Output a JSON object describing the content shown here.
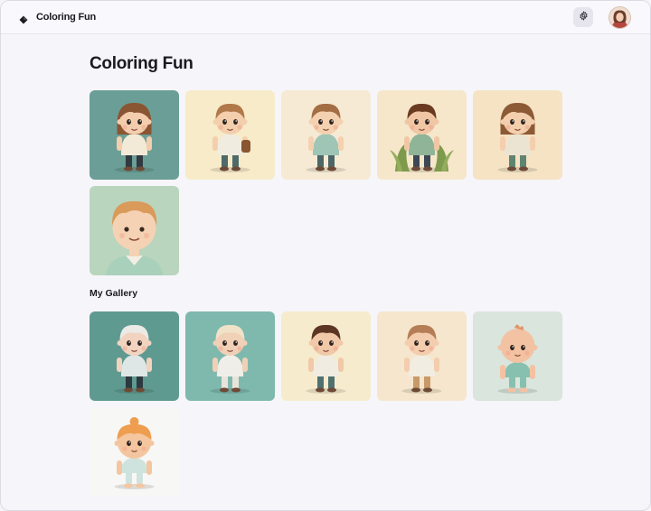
{
  "app": {
    "name": "Coloring Fun",
    "logo_icon": "diamond-logo-icon"
  },
  "header": {
    "settings_icon": "gear-icon",
    "avatar": "user-avatar"
  },
  "page": {
    "title": "Coloring Fun"
  },
  "sections": [
    {
      "id": "featured",
      "title": "",
      "tiles": [
        {
          "bg": "#6b9e96",
          "skin": "#f3cdae",
          "hair": "#8a5532",
          "shirt": "#f2ead7",
          "pants": "#2f3a41",
          "style": "girl-bob"
        },
        {
          "bg": "#f7ebc9",
          "skin": "#f3cfae",
          "hair": "#b1784a",
          "shirt": "#f0ecdf",
          "pants": "#4f6a6a",
          "style": "boy-backpack"
        },
        {
          "bg": "#f6ead4",
          "skin": "#f4d1b0",
          "hair": "#a46e45",
          "shirt": "#9fc5b6",
          "pants": "#4c6667",
          "style": "boy-short"
        },
        {
          "bg": "#f6e7cb",
          "skin": "#f0c6a4",
          "hair": "#6a3a21",
          "shirt": "#8fb497",
          "pants": "#3c4856",
          "style": "boy-plants"
        },
        {
          "bg": "#f5e3c4",
          "skin": "#f4cfae",
          "hair": "#8d5a36",
          "shirt": "#ece4d2",
          "pants": "#5f8572",
          "style": "girl-bob"
        },
        {
          "bg": "#b9d5bd",
          "skin": "#f5d2b3",
          "hair": "#d99a5a",
          "shirt": "#a9d0bb",
          "pants": "#8fbba6",
          "style": "boy-bust"
        }
      ]
    },
    {
      "id": "gallery",
      "title": "My Gallery",
      "tiles": [
        {
          "bg": "#5f9a91",
          "skin": "#f1d3c0",
          "hair": "#eceae6",
          "shirt": "#dfe6e6",
          "pants": "#2c3940",
          "style": "boy-white"
        },
        {
          "bg": "#7fb9ae",
          "skin": "#f0d0b7",
          "hair": "#efe2c8",
          "shirt": "#f0eee8",
          "pants": "#e8e4dc",
          "style": "boy-white"
        },
        {
          "bg": "#f6ebcd",
          "skin": "#f1c9a8",
          "hair": "#5c3623",
          "shirt": "#f1ece2",
          "pants": "#4f7270",
          "style": "boy-short"
        },
        {
          "bg": "#f5e6cd",
          "skin": "#f3cdae",
          "hair": "#b57e56",
          "shirt": "#f2ede3",
          "pants": "#c89a6a",
          "style": "boy-short"
        },
        {
          "bg": "#d9e5dd",
          "skin": "#f3c2a2",
          "hair": "#e29468",
          "shirt": "#88c0b0",
          "pants": "#88c0b0",
          "style": "baby"
        },
        {
          "bg": "#f7f7f6",
          "skin": "#f4c6a0",
          "hair": "#ef9d4f",
          "shirt": "#cfe3de",
          "pants": "#cfe3de",
          "style": "baby-bun"
        }
      ]
    }
  ]
}
